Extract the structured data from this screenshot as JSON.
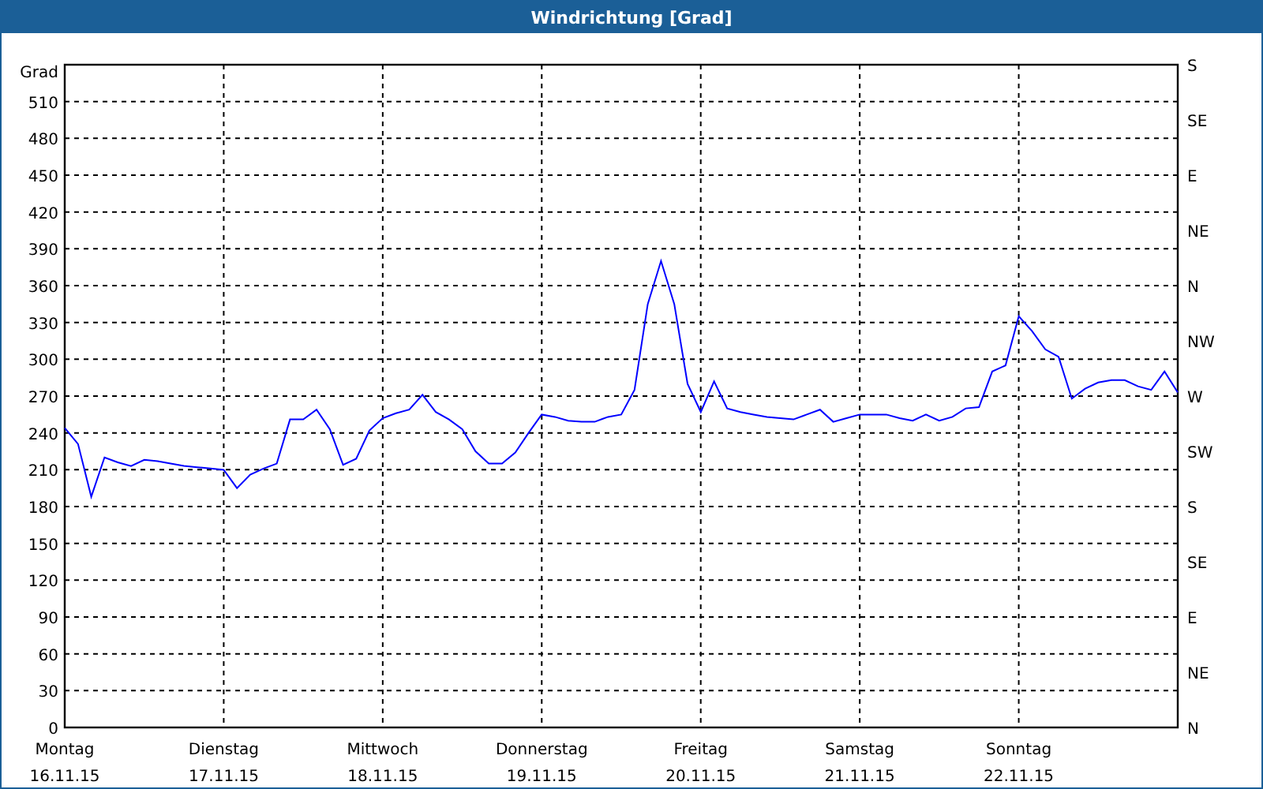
{
  "window": {
    "title": "Windrichtung [Grad]"
  },
  "chart": {
    "compass_labels": [
      "S",
      "SE",
      "E",
      "NE",
      "N",
      "NW",
      "W",
      "SW",
      "S",
      "SE",
      "E",
      "NE",
      "N"
    ],
    "dates": [
      "16.11.15",
      "17.11.15",
      "18.11.15",
      "19.11.15",
      "20.11.15",
      "21.11.15",
      "22.11.15"
    ],
    "chart_data": {
      "type": "line",
      "grid": true,
      "ylabel": "Grad",
      "ylim": [
        0,
        540
      ],
      "yticks": [
        {
          "value": 0,
          "label": "0"
        },
        {
          "value": 30,
          "label": "30"
        },
        {
          "value": 60,
          "label": "60"
        },
        {
          "value": 90,
          "label": "90"
        },
        {
          "value": 120,
          "label": "120"
        },
        {
          "value": 150,
          "label": "150"
        },
        {
          "value": 180,
          "label": "180"
        },
        {
          "value": 210,
          "label": "210"
        },
        {
          "value": 240,
          "label": "240"
        },
        {
          "value": 270,
          "label": "270"
        },
        {
          "value": 300,
          "label": "300"
        },
        {
          "value": 330,
          "label": "330"
        },
        {
          "value": 360,
          "label": "360"
        },
        {
          "value": 390,
          "label": "390"
        },
        {
          "value": 420,
          "label": "420"
        },
        {
          "value": 450,
          "label": "450"
        },
        {
          "value": 480,
          "label": "480"
        },
        {
          "value": 510,
          "label": "510"
        }
      ],
      "categories": [
        "Montag",
        null,
        null,
        null,
        null,
        null,
        null,
        null,
        null,
        null,
        null,
        null,
        "Dienstag",
        null,
        null,
        null,
        null,
        null,
        null,
        null,
        null,
        null,
        null,
        null,
        "Mittwoch",
        null,
        null,
        null,
        null,
        null,
        null,
        null,
        null,
        null,
        null,
        null,
        "Donnerstag",
        null,
        null,
        null,
        null,
        null,
        null,
        null,
        null,
        null,
        null,
        null,
        "Freitag",
        null,
        null,
        null,
        null,
        null,
        null,
        null,
        null,
        null,
        null,
        null,
        "Samstag",
        null,
        null,
        null,
        null,
        null,
        null,
        null,
        null,
        null,
        null,
        null,
        "Sonntag",
        null,
        null,
        null,
        null,
        null,
        null,
        null,
        null,
        null,
        null,
        null,
        null
      ],
      "series": [
        {
          "color": "#0000ff",
          "values": [
            244,
            231,
            188,
            220,
            216,
            213,
            218,
            217,
            215,
            213,
            212,
            211,
            210,
            195,
            206,
            211,
            215,
            251,
            251,
            259,
            243,
            214,
            219,
            242,
            252,
            256,
            259,
            271,
            257,
            251,
            243,
            225,
            215,
            215,
            224,
            240,
            255,
            253,
            250,
            249,
            249,
            253,
            255,
            275,
            345,
            380,
            345,
            280,
            257,
            282,
            260,
            257,
            255,
            253,
            252,
            251,
            255,
            259,
            249,
            252,
            255,
            255,
            255,
            252,
            250,
            255,
            250,
            253,
            260,
            261,
            290,
            295,
            335,
            323,
            308,
            302,
            268,
            276,
            281,
            283,
            283,
            278,
            275,
            290,
            273
          ]
        }
      ]
    }
  }
}
